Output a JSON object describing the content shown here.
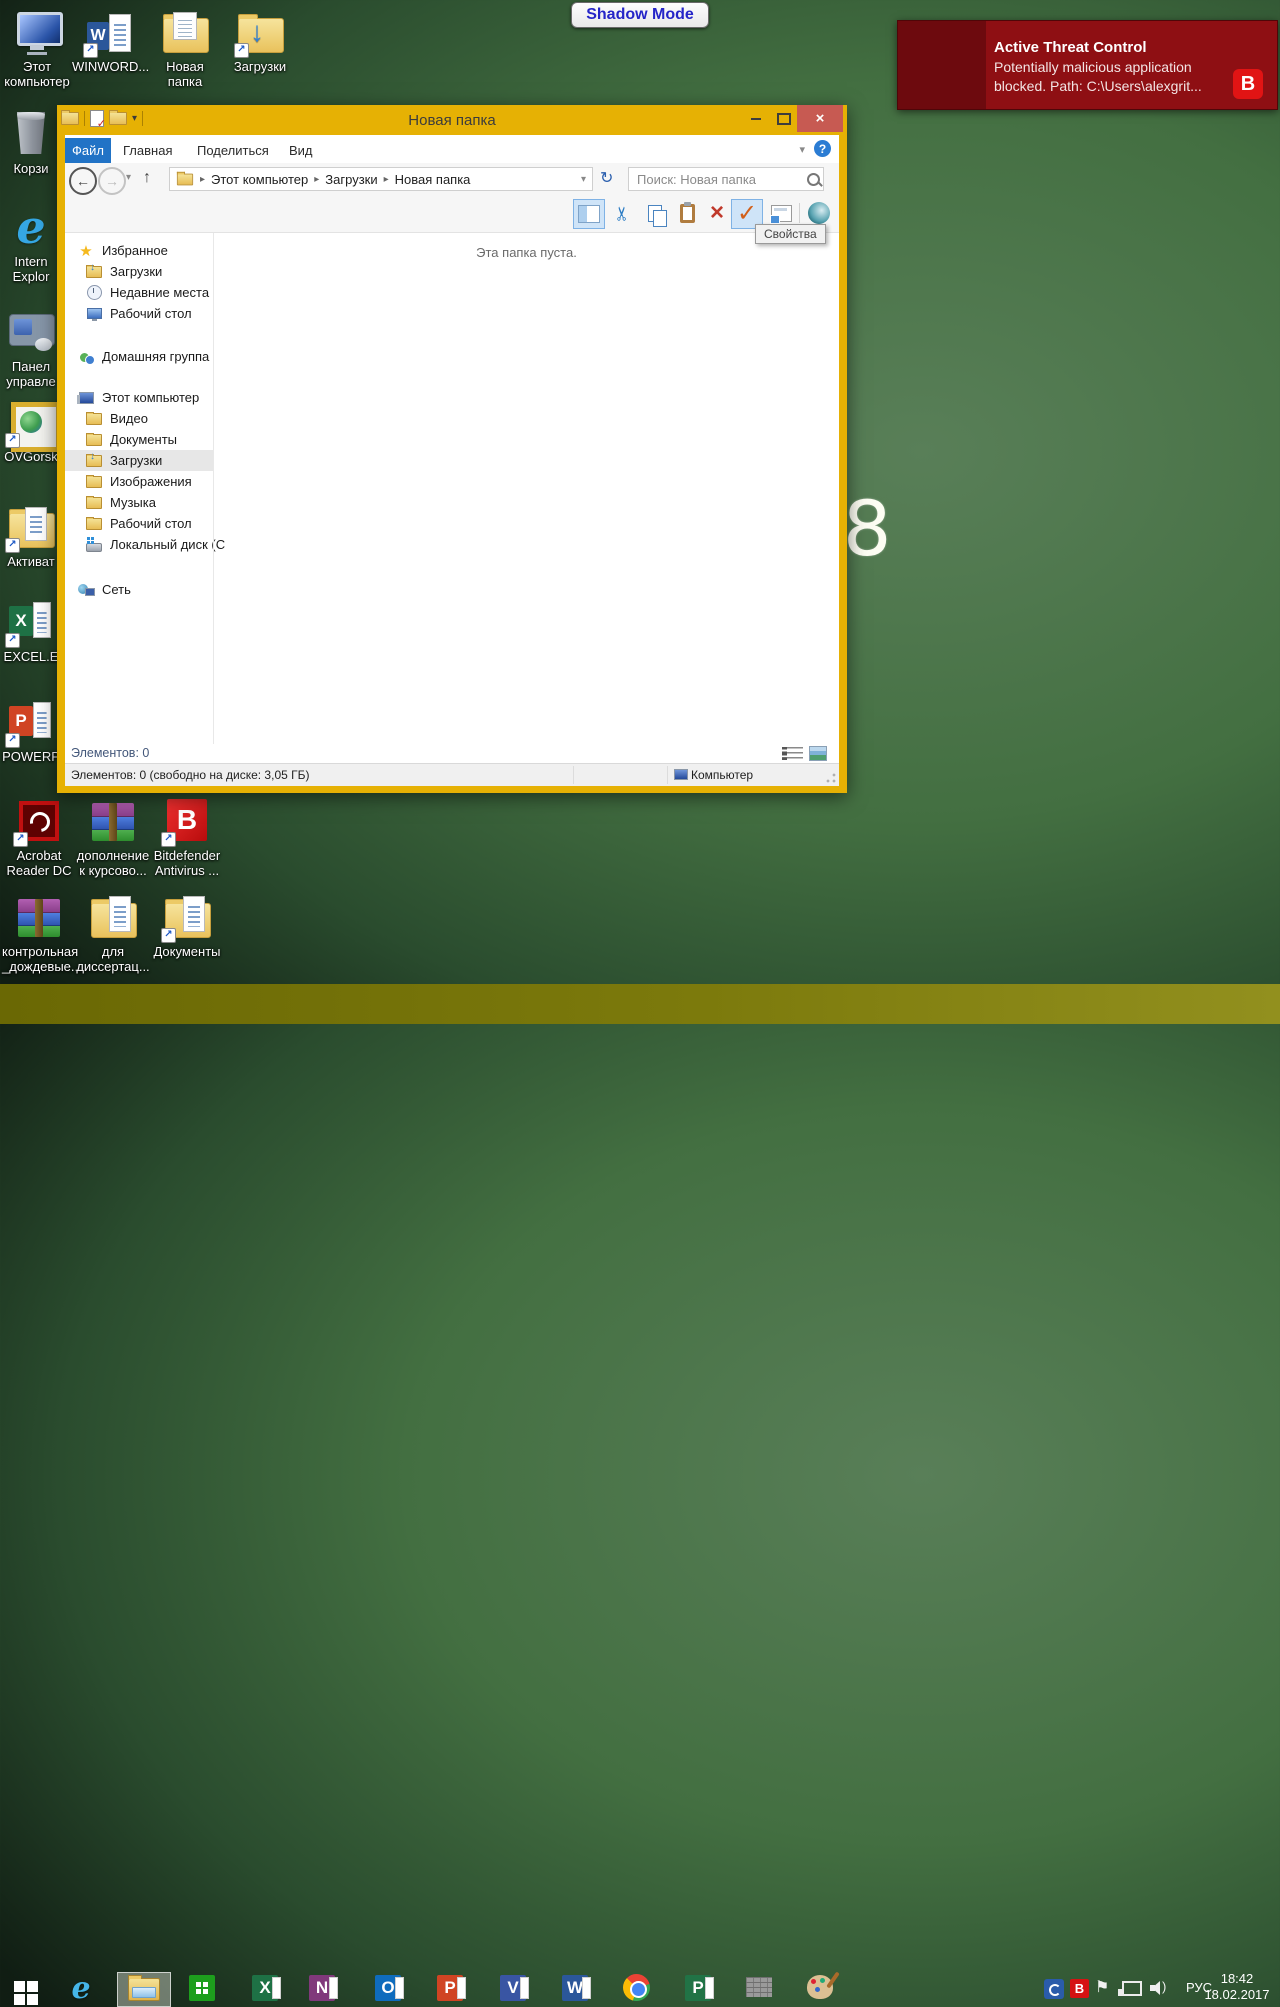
{
  "shadow_mode": "Shadow Mode",
  "notification": {
    "title": "Active Threat Control",
    "body_line1": "Potentially malicious application",
    "body_line2": "blocked. Path: C:\\Users\\alexgrit...",
    "brand_letter": "B"
  },
  "wallpaper_digit": "8",
  "desktop_icons": {
    "top": [
      {
        "label1": "Этот",
        "label2": "компьютер"
      },
      {
        "label1": "WINWORD..."
      },
      {
        "label1": "Новая папка"
      },
      {
        "label1": "Загрузки"
      }
    ],
    "left": [
      {
        "label1": "Корзи"
      },
      {
        "label1": "Intern",
        "label2": "Explor"
      },
      {
        "label1": "Панел",
        "label2": "управле"
      },
      {
        "label1": "OVGorsk"
      },
      {
        "label1": "Активат"
      },
      {
        "label1": "EXCEL.E"
      },
      {
        "label1": "POWERP"
      }
    ],
    "bottom": [
      {
        "label1": "Acrobat",
        "label2": "Reader DC"
      },
      {
        "label1": "дополнение",
        "label2": "к курсово..."
      },
      {
        "label1": "Bitdefender",
        "label2": "Antivirus ..."
      },
      {
        "label1": "контрольная",
        "label2": "_дождевые..."
      },
      {
        "label1": "для",
        "label2": "диссертац..."
      },
      {
        "label1": "Документы"
      }
    ]
  },
  "window": {
    "title": "Новая папка",
    "tabs": {
      "file": "Файл",
      "home": "Главная",
      "share": "Поделиться",
      "view": "Вид"
    },
    "breadcrumb": {
      "item1": "Этот компьютер",
      "item2": "Загрузки",
      "item3": "Новая папка"
    },
    "search_placeholder": "Поиск: Новая папка",
    "tooltip_properties": "Свойства",
    "empty_message": "Эта папка пуста.",
    "sidebar": {
      "favorites": "Избранное",
      "fav_items": [
        "Загрузки",
        "Недавние места",
        "Рабочий стол"
      ],
      "homegroup": "Домашняя группа",
      "this_pc": "Этот компьютер",
      "pc_items": [
        "Видео",
        "Документы",
        "Загрузки",
        "Изображения",
        "Музыка",
        "Рабочий стол",
        "Локальный диск (C"
      ],
      "network": "Сеть"
    },
    "status_items": "Элементов: 0",
    "status_detail": "Элементов: 0 (свободно на диске: 3,05 ГБ)",
    "status_location": "Компьютер"
  },
  "taskbar": {
    "language": "РУС",
    "time": "18:42",
    "date": "18.02.2017"
  },
  "app_letters": {
    "word": "W",
    "excel": "X",
    "powerpoint": "P",
    "onenote": "N",
    "outlook": "O",
    "visio": "V",
    "project": "P",
    "internet_explorer": "e",
    "bitdefender": "B"
  },
  "glyphs": {
    "back": "←",
    "forward": "→",
    "up": "↑",
    "dropdown": "▾",
    "refresh": "↻",
    "crumb_sep": "▸",
    "chevron_expand": "▾",
    "help": "?",
    "close": "×",
    "scissors": "✂",
    "check": "✓",
    "delete": "×",
    "star": "★",
    "flag": "⚑",
    "shortcut_arrow": "↗",
    "qat_check": "✓",
    "volume_wave": ")"
  }
}
